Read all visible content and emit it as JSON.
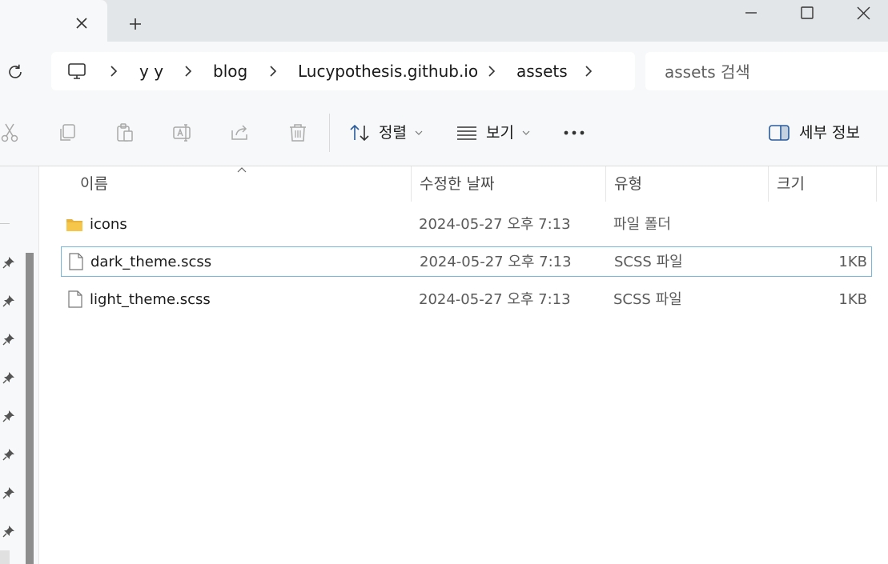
{
  "tab": {
    "close_icon": "close-icon",
    "new_tab_icon": "plus-icon"
  },
  "window_controls": [
    "minimize-icon",
    "maximize-icon",
    "close-icon"
  ],
  "address": {
    "root_icon": "monitor-icon",
    "breadcrumbs": [
      "y y",
      "blog",
      "Lucypothesis.github.io",
      "assets"
    ]
  },
  "search": {
    "placeholder": "assets 검색"
  },
  "toolbar": {
    "icons": [
      "cut-icon",
      "copy-icon",
      "paste-icon",
      "rename-icon",
      "share-icon",
      "delete-icon"
    ],
    "sort_label": "정렬",
    "view_label": "보기",
    "more_icon": "more-icon",
    "details_label": "세부 정보"
  },
  "columns": {
    "name": "이름",
    "date": "수정한 날짜",
    "type": "유형",
    "size": "크기"
  },
  "files": [
    {
      "name": "icons",
      "date": "2024-05-27 오후 7:13",
      "type": "파일 폴더",
      "size": "",
      "icon": "folder-icon",
      "selected": false
    },
    {
      "name": "dark_theme.scss",
      "date": "2024-05-27 오후 7:13",
      "type": "SCSS 파일",
      "size": "1KB",
      "icon": "file-icon",
      "selected": true
    },
    {
      "name": "light_theme.scss",
      "date": "2024-05-27 오후 7:13",
      "type": "SCSS 파일",
      "size": "1KB",
      "icon": "file-icon",
      "selected": false
    }
  ],
  "nav_pins": 8,
  "colors": {
    "selection_border": "#79b8dc",
    "folder": "#f5c64a",
    "chrome_bg": "#f7f8f9"
  }
}
